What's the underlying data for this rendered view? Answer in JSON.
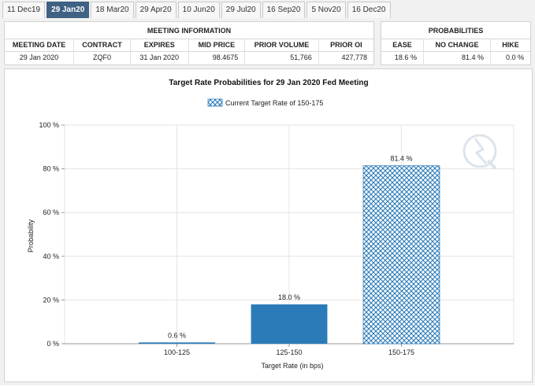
{
  "tabs": [
    "11 Dec19",
    "29 Jan20",
    "18 Mar20",
    "29 Apr20",
    "10 Jun20",
    "29 Jul20",
    "16 Sep20",
    "5 Nov20",
    "16 Dec20"
  ],
  "active_tab": 1,
  "meeting_info": {
    "title": "MEETING INFORMATION",
    "headers": [
      "MEETING DATE",
      "CONTRACT",
      "EXPIRES",
      "MID PRICE",
      "PRIOR VOLUME",
      "PRIOR OI"
    ],
    "row": [
      "29 Jan 2020",
      "ZQF0",
      "31 Jan 2020",
      "98.4675",
      "51,766",
      "427,778"
    ]
  },
  "probabilities": {
    "title": "PROBABILITIES",
    "headers": [
      "EASE",
      "NO CHANGE",
      "HIKE"
    ],
    "row": [
      "18.6 %",
      "81.4 %",
      "0.0 %"
    ]
  },
  "chart_data": {
    "type": "bar",
    "title": "Target Rate Probabilities for 29 Jan 2020 Fed Meeting",
    "legend": "Current Target Rate of 150-175",
    "xlabel": "Target Rate (in bps)",
    "ylabel": "Probability",
    "categories": [
      "100-125",
      "125-150",
      "150-175"
    ],
    "values": [
      0.6,
      18.0,
      81.4
    ],
    "value_labels": [
      "0.6 %",
      "18.0 %",
      "81.4 %"
    ],
    "highlight_category": "150-175",
    "ylim": [
      0,
      100
    ],
    "yticks": [
      "0 %",
      "20 %",
      "40 %",
      "60 %",
      "80 %",
      "100 %"
    ],
    "grid": true,
    "colors": {
      "bar": "#2b7bb9",
      "highlight": "#2b7bb9",
      "grid": "#e4e4e4"
    }
  }
}
